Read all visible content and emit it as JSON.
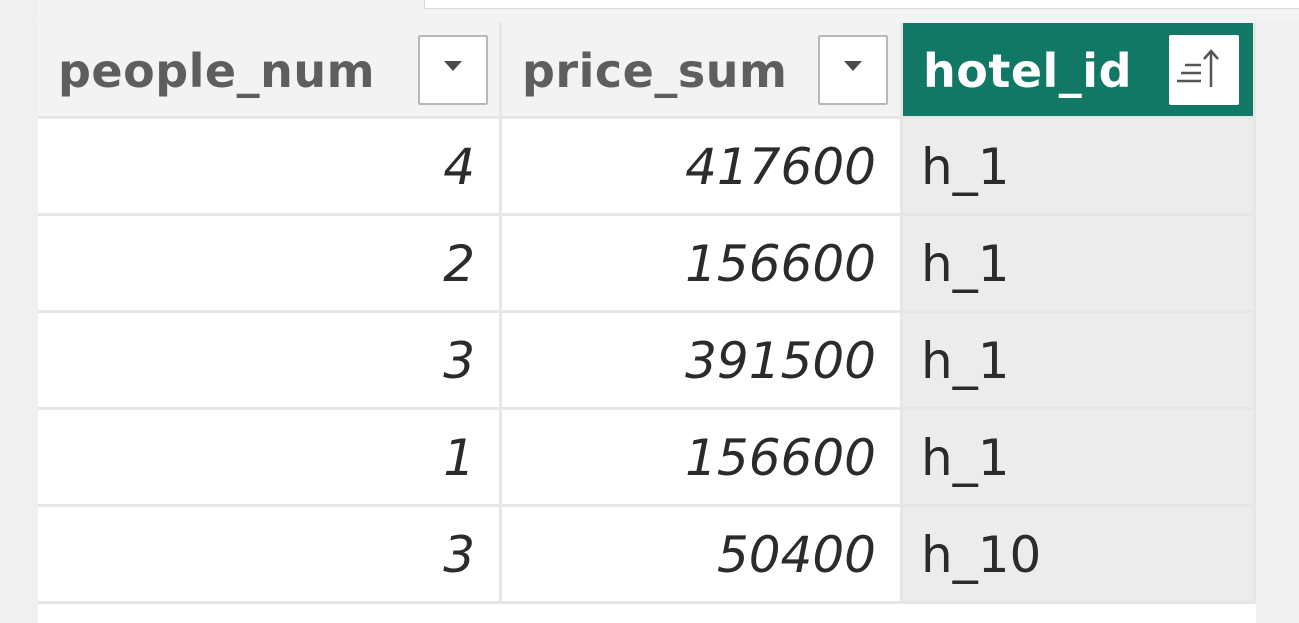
{
  "table": {
    "columns": [
      {
        "key": "people_num",
        "label": "people_num",
        "align": "right",
        "header_icon": "filter-dropdown-icon",
        "selected": false
      },
      {
        "key": "price_sum",
        "label": "price_sum",
        "align": "right",
        "header_icon": "filter-dropdown-icon",
        "selected": false
      },
      {
        "key": "hotel_id",
        "label": "hotel_id",
        "align": "left",
        "header_icon": "sort-ascending-icon",
        "selected": true
      }
    ],
    "rows": [
      {
        "people_num": "4",
        "price_sum": "417600",
        "hotel_id": "h_1"
      },
      {
        "people_num": "2",
        "price_sum": "156600",
        "hotel_id": "h_1"
      },
      {
        "people_num": "3",
        "price_sum": "391500",
        "hotel_id": "h_1"
      },
      {
        "people_num": "1",
        "price_sum": "156600",
        "hotel_id": "h_1"
      },
      {
        "people_num": "3",
        "price_sum": "50400",
        "hotel_id": "h_10"
      }
    ]
  },
  "colors": {
    "selected_header_bg": "#117865",
    "selected_column_bg": "#ececec",
    "header_bg": "#f3f3f3",
    "header_text": "#605e5c",
    "cell_text": "#2b2b2b",
    "grid_line": "#e6e6e6"
  }
}
